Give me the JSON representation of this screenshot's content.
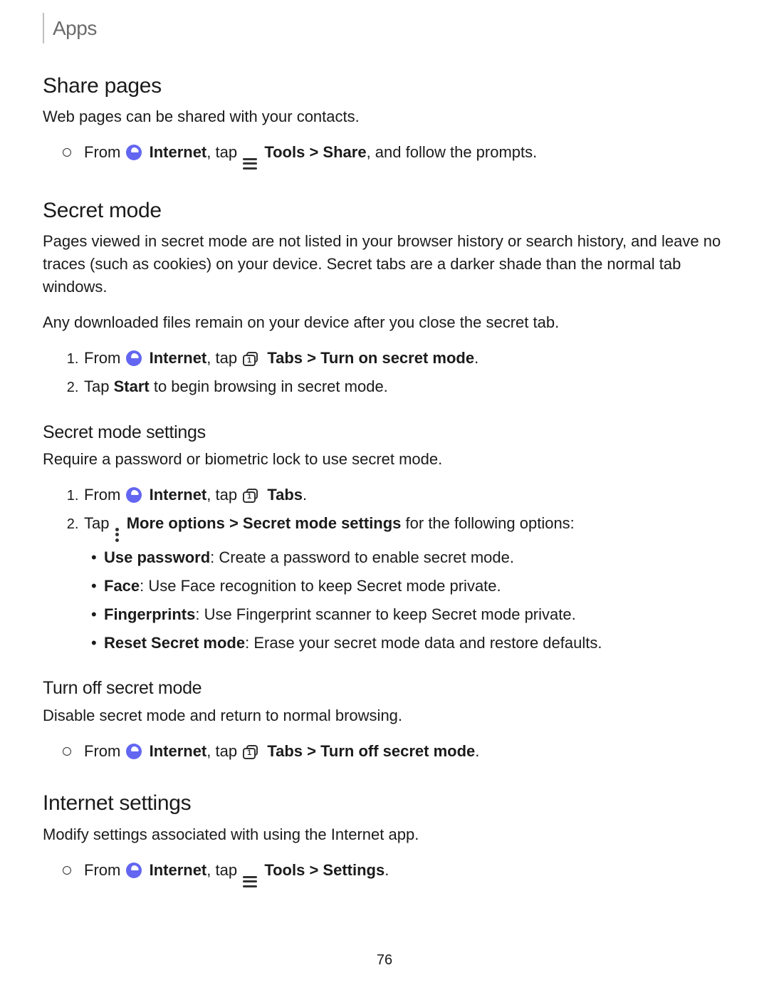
{
  "header": {
    "title": "Apps"
  },
  "share_pages": {
    "heading": "Share pages",
    "intro": "Web pages can be shared with your contacts.",
    "step1": {
      "t1": "From ",
      "internet": "Internet",
      "t2": ", tap ",
      "tools": "Tools",
      "gt": " > ",
      "share": "Share",
      "t3": ", and follow the prompts."
    }
  },
  "secret_mode": {
    "heading": "Secret mode",
    "p1": "Pages viewed in secret mode are not listed in your browser history or search history, and leave no traces (such as cookies) on your device. Secret tabs are a darker shade than the normal tab windows.",
    "p2": "Any downloaded files remain on your device after you close the secret tab.",
    "step1": {
      "t1": "From ",
      "internet": "Internet",
      "t2": ", tap ",
      "tabs": "Tabs",
      "gt": " > ",
      "action": "Turn on secret mode",
      "t3": "."
    },
    "step2": {
      "t1": "Tap ",
      "start": "Start",
      "t2": " to begin browsing in secret mode."
    },
    "settings": {
      "heading": "Secret mode settings",
      "intro": "Require a password or biometric lock to use secret mode.",
      "s1": {
        "t1": "From ",
        "internet": "Internet",
        "t2": ", tap ",
        "tabs": "Tabs",
        "t3": "."
      },
      "s2": {
        "t1": "Tap ",
        "more": "More options",
        "gt": " > ",
        "sms": "Secret mode settings",
        "t2": " for the following options:"
      },
      "opts": {
        "use_password": {
          "label": "Use password",
          "desc": ": Create a password to enable secret mode."
        },
        "face": {
          "label": "Face",
          "desc": ": Use Face recognition to keep Secret mode private."
        },
        "fingerprints": {
          "label": "Fingerprints",
          "desc": ": Use Fingerprint scanner to keep Secret mode private."
        },
        "reset": {
          "label": "Reset Secret mode",
          "desc": ": Erase your secret mode data and restore defaults."
        }
      }
    },
    "turn_off": {
      "heading": "Turn off secret mode",
      "intro": "Disable secret mode and return to normal browsing.",
      "step": {
        "t1": "From ",
        "internet": "Internet",
        "t2": ", tap ",
        "tabs": "Tabs",
        "gt": " > ",
        "action": "Turn off secret mode",
        "t3": "."
      }
    }
  },
  "internet_settings": {
    "heading": "Internet settings",
    "intro": "Modify settings associated with using the Internet app.",
    "step": {
      "t1": "From ",
      "internet": "Internet",
      "t2": ", tap ",
      "tools": "Tools",
      "gt": " > ",
      "settings": "Settings",
      "t3": "."
    }
  },
  "page_number": "76"
}
